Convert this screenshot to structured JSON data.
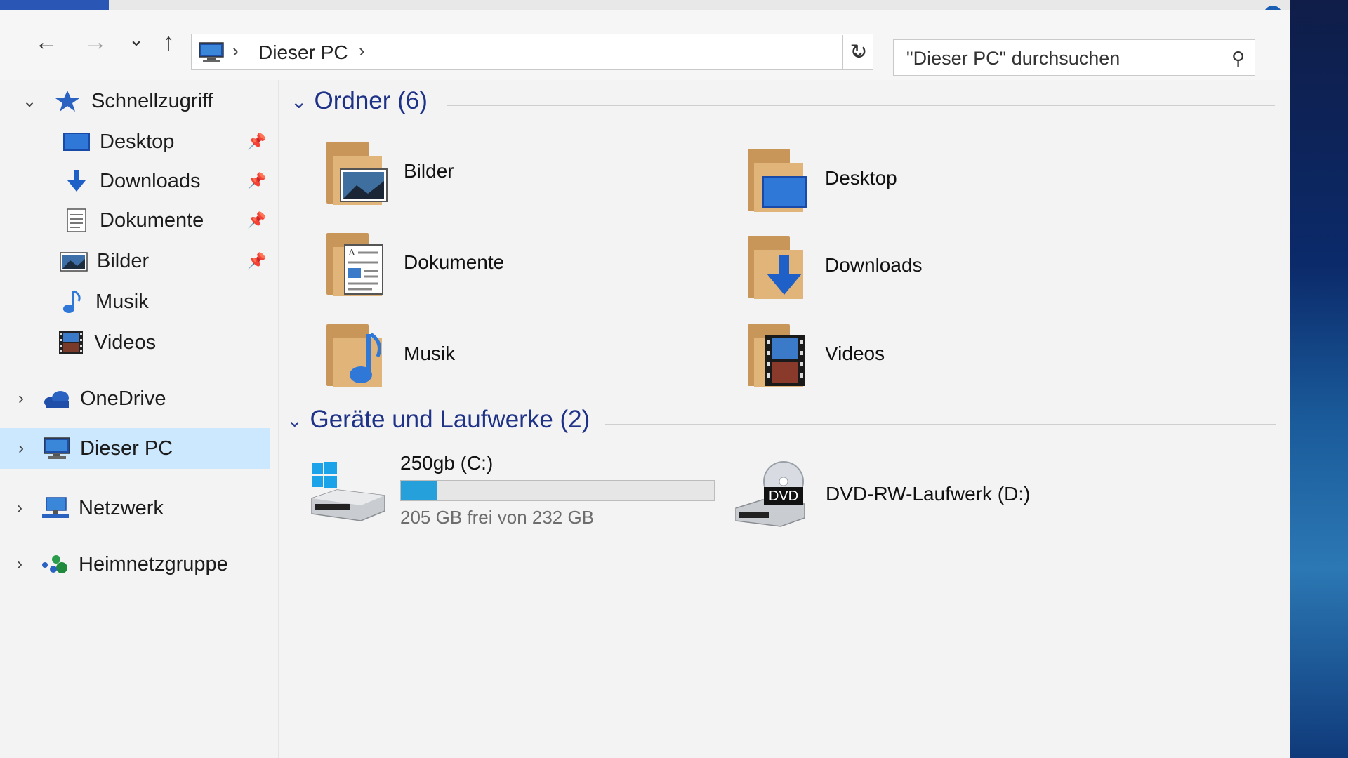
{
  "window": {
    "navigation": {
      "back_glyph": "←",
      "forward_glyph": "→",
      "recent_glyph": "⌄",
      "up_glyph": "↑"
    },
    "address": {
      "crumb": "Dieser PC",
      "separator": "›"
    },
    "search": {
      "placeholder": "\"Dieser PC\" durchsuchen"
    }
  },
  "sidebar": {
    "quick_access": {
      "label": "Schnellzugriff",
      "icon": "star-icon"
    },
    "quick_items": [
      {
        "label": "Desktop",
        "icon": "desktop-icon",
        "pinned": true
      },
      {
        "label": "Downloads",
        "icon": "download-icon",
        "pinned": true
      },
      {
        "label": "Dokumente",
        "icon": "documents-icon",
        "pinned": true
      },
      {
        "label": "Bilder",
        "icon": "pictures-icon",
        "pinned": true
      },
      {
        "label": "Musik",
        "icon": "music-icon",
        "pinned": false
      },
      {
        "label": "Videos",
        "icon": "videos-icon",
        "pinned": false
      }
    ],
    "onedrive": {
      "label": "OneDrive",
      "icon": "cloud-icon"
    },
    "this_pc": {
      "label": "Dieser PC",
      "icon": "computer-icon",
      "selected": true
    },
    "network": {
      "label": "Netzwerk",
      "icon": "network-icon"
    },
    "homegroup": {
      "label": "Heimnetzgruppe",
      "icon": "homegroup-icon"
    }
  },
  "main": {
    "folders_header": "Ordner (6)",
    "folders": [
      {
        "label": "Bilder",
        "icon": "pictures-folder-icon"
      },
      {
        "label": "Desktop",
        "icon": "desktop-folder-icon"
      },
      {
        "label": "Dokumente",
        "icon": "documents-folder-icon"
      },
      {
        "label": "Downloads",
        "icon": "downloads-folder-icon"
      },
      {
        "label": "Musik",
        "icon": "music-folder-icon"
      },
      {
        "label": "Videos",
        "icon": "videos-folder-icon"
      }
    ],
    "drives_header": "Geräte und Laufwerke (2)",
    "drives": [
      {
        "label": "250gb (C:)",
        "free_text": "205 GB frei von 232 GB",
        "used_fraction": 0.116,
        "icon": "windows-drive-icon"
      },
      {
        "label": "DVD-RW-Laufwerk (D:)",
        "icon": "dvd-drive-icon",
        "badge": "DVD"
      }
    ]
  },
  "colors": {
    "header_blue": "#1e3287",
    "selection": "#cce8ff",
    "usage_fill": "#26a0da",
    "folder_tan": "#e1b479"
  }
}
